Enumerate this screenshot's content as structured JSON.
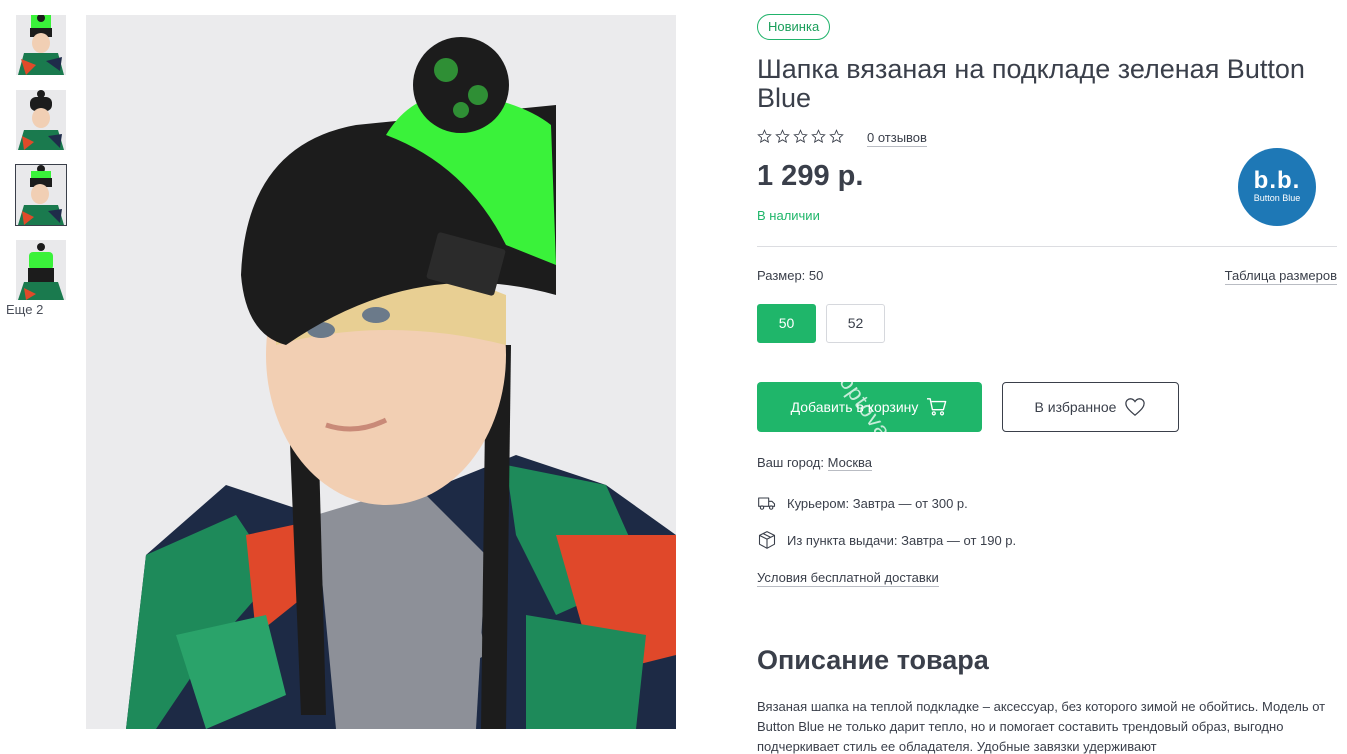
{
  "gallery": {
    "thumbnails": [
      {
        "alt": "thumb-1"
      },
      {
        "alt": "thumb-2"
      },
      {
        "alt": "thumb-3"
      },
      {
        "alt": "thumb-4"
      }
    ],
    "more_label": "Еще 2"
  },
  "product": {
    "badge": "Новинка",
    "title": "Шапка вязаная на подкладе зеленая Button Blue",
    "reviews_label": "0 отзывов",
    "rating": 0,
    "rating_max": 5,
    "price": "1 299 р.",
    "stock": "В наличии",
    "brand": {
      "logo_text": "b.b.",
      "logo_name": "Button Blue",
      "color": "#1e78b6"
    }
  },
  "size": {
    "label": "Размер: 50",
    "table_link": "Таблица размеров",
    "options": [
      "50",
      "52"
    ],
    "selected": "50"
  },
  "actions": {
    "add_to_cart": "Добавить в корзину",
    "favorite": "В избранное",
    "watermark": "optovaru"
  },
  "delivery": {
    "city_label": "Ваш город:",
    "city": "Москва",
    "courier": "Курьером: Завтра — от 300 р.",
    "pickup": "Из пункта выдачи: Завтра — от 190 р.",
    "free_link": "Условия бесплатной доставки"
  },
  "description": {
    "title": "Описание товара",
    "text": "Вязаная шапка на теплой подкладке – аксессуар, без которого зимой не обойтись. Модель от Button Blue не только дарит тепло, но и помогает составить трендовый образ, выгодно подчеркивает стиль ее обладателя. Удобные завязки удерживают"
  },
  "colors": {
    "accent": "#1fb66a",
    "text": "#3a3f4a",
    "brand_blue": "#1e78b6",
    "hat_green": "#3af23a",
    "hat_black": "#1c1c1c"
  }
}
